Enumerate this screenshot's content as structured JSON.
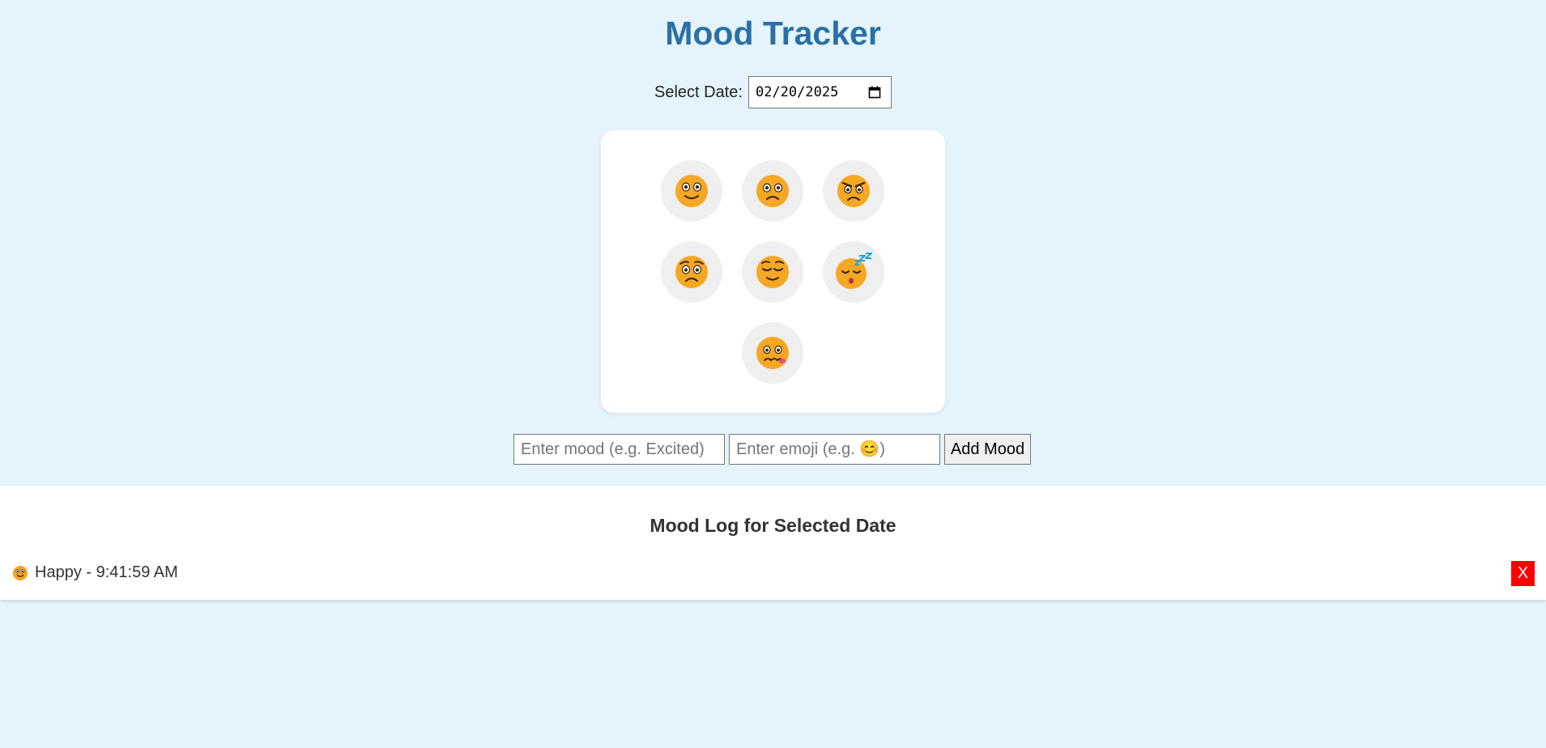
{
  "app": {
    "title": "Mood Tracker"
  },
  "date_picker": {
    "label": "Select Date:",
    "value": "02/20/2025"
  },
  "moods": [
    {
      "name": "Happy",
      "icon": "happy-face-icon"
    },
    {
      "name": "Sad",
      "icon": "sad-face-icon"
    },
    {
      "name": "Angry",
      "icon": "angry-face-icon"
    },
    {
      "name": "Worried",
      "icon": "worried-face-icon"
    },
    {
      "name": "Relieved",
      "icon": "relieved-face-icon"
    },
    {
      "name": "Sleepy",
      "icon": "sleeping-face-icon"
    },
    {
      "name": "Sick",
      "icon": "woozy-face-icon"
    }
  ],
  "add_mood": {
    "mood_placeholder": "Enter mood (e.g. Excited)",
    "emoji_placeholder": "Enter emoji (e.g. 😊)",
    "button_label": "Add Mood"
  },
  "log": {
    "title": "Mood Log for Selected Date",
    "entries": [
      {
        "icon": "happy-face-icon",
        "text": "Happy - 9:41:59 AM",
        "delete_label": "X"
      }
    ]
  },
  "colors": {
    "background": "#e5f4fc",
    "title": "#2a70a6",
    "face": "#f6a723",
    "delete": "#ff0000"
  }
}
